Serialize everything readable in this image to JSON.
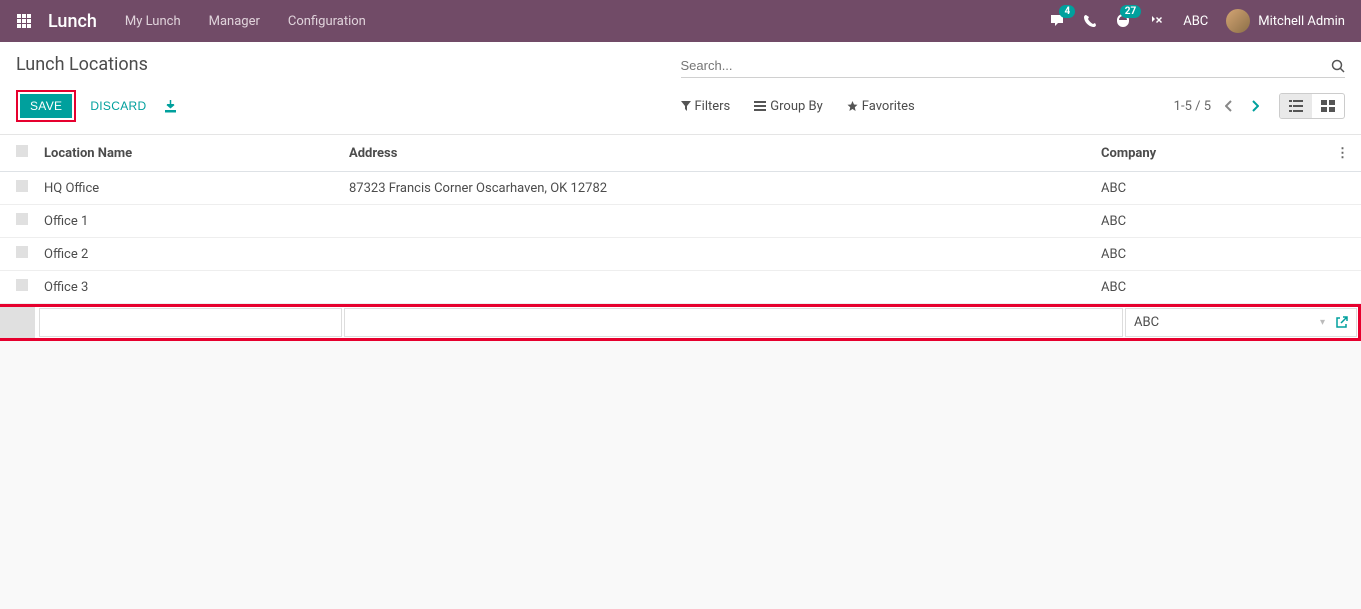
{
  "navbar": {
    "brand": "Lunch",
    "menu": [
      "My Lunch",
      "Manager",
      "Configuration"
    ],
    "chat_badge": "4",
    "activity_badge": "27",
    "company": "ABC",
    "user": "Mitchell Admin"
  },
  "control": {
    "title": "Lunch Locations",
    "search_placeholder": "Search...",
    "save_label": "SAVE",
    "discard_label": "DISCARD",
    "filters_label": "Filters",
    "groupby_label": "Group By",
    "favorites_label": "Favorites",
    "pager": "1-5 / 5"
  },
  "table": {
    "headers": {
      "name": "Location Name",
      "address": "Address",
      "company": "Company"
    },
    "rows": [
      {
        "name": "HQ Office",
        "address": "87323 Francis Corner Oscarhaven, OK 12782",
        "company": "ABC"
      },
      {
        "name": "Office 1",
        "address": "",
        "company": "ABC"
      },
      {
        "name": "Office 2",
        "address": "",
        "company": "ABC"
      },
      {
        "name": "Office 3",
        "address": "",
        "company": "ABC"
      }
    ],
    "edit_row": {
      "name": "",
      "address": "",
      "company": "ABC"
    }
  }
}
